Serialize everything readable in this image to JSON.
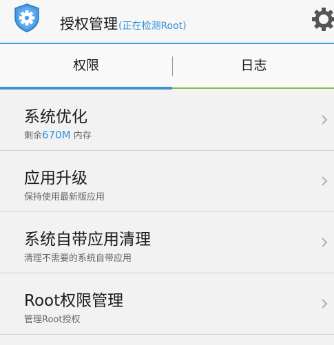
{
  "header": {
    "title": "授权管理",
    "status": "(正在检测Root)"
  },
  "tabs": [
    {
      "label": "权限",
      "active": true
    },
    {
      "label": "日志",
      "active": false
    }
  ],
  "items": [
    {
      "title": "系统优化",
      "sub_prefix": "剩余",
      "sub_highlight": "670M",
      "sub_suffix": " 内存"
    },
    {
      "title": "应用升级",
      "sub": "保持使用最新版应用"
    },
    {
      "title": "系统自带应用清理",
      "sub": "清理不需要的系统自带应用"
    },
    {
      "title": "Root权限管理",
      "sub": "管理Root授权"
    }
  ],
  "colors": {
    "accent_blue": "#3d92d8",
    "accent_green": "#7ac043",
    "highlight_text": "#2f8fd8"
  },
  "icons": {
    "app": "shield-gear-icon",
    "settings": "gear-icon",
    "chevron": "chevron-right-icon"
  }
}
